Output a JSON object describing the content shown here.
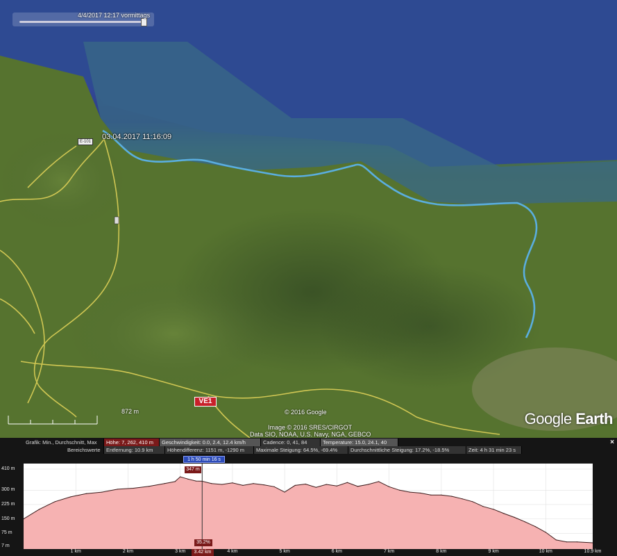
{
  "map": {
    "time_slider_label": "4/4/2017 12:17 vormittags",
    "track_timestamp": "03.04.2017 11:16:09",
    "road_badge": "VE1",
    "small_badge": "E-101",
    "scale_label": "872 m",
    "credit_copyright": "© 2016 Google",
    "credit_image": "Image © 2016 SRES/CIRGOT",
    "credit_data": "Data SIO, NOAA, U.S. Navy, NGA, GEBCO",
    "logo_google": "Google",
    "logo_earth": "Earth",
    "track_color": "#5aaee0",
    "road_color": "#e6d65a"
  },
  "profile": {
    "row1_header": "Grafik: Min., Durchschnitt, Max",
    "row1_hoehe": "Höhe: 7, 262, 410 m",
    "row1_speed": "Geschwindigkeit: 0.0, 2.4, 12.4 km/h",
    "row1_cadence": "Cadence: 0, 41, 84",
    "row1_temp": "Temperature: 15.0, 24.1, 40",
    "row2_header": "Bereichswerte",
    "row2_distance": "Entfernung: 10.9 km",
    "row2_hdiff": "Höhendifferenz: 1151 m, -1290 m",
    "row2_maxslope": "Maximale Steigung: 64.5%, -69.4%",
    "row2_avgslope": "Durchschnittliche Steigung: 17.2%, -18.5%",
    "row2_time": "Zeit: 4 h 31 min 23 s",
    "close": "×",
    "cursor_time": "1 h 50 min 16 s",
    "cursor_alt": "347 m",
    "cursor_grade": "35.2%",
    "cursor_dist": "3.42 km",
    "fill_color": "#f6b2b2",
    "line_color": "#3b1a1a"
  },
  "chart_data": {
    "type": "area",
    "title": "",
    "xlabel": "",
    "ylabel": "",
    "x_unit": "km",
    "y_unit": "m",
    "xlim": [
      0,
      10.9
    ],
    "ylim": [
      7,
      410
    ],
    "y_ticks": [
      "410 m",
      "300 m",
      "225 m",
      "150 m",
      "75 m",
      "7 m"
    ],
    "y_tick_values": [
      410,
      300,
      225,
      150,
      75,
      7
    ],
    "x_ticks": [
      "1 km",
      "2 km",
      "3 km",
      "4 km",
      "5 km",
      "6 km",
      "7 km",
      "8 km",
      "9 km",
      "10 km",
      "10.9 km"
    ],
    "x_tick_values": [
      1,
      2,
      3,
      4,
      5,
      6,
      7,
      8,
      9,
      10,
      10.9
    ],
    "series": [
      {
        "x": [
          0,
          0.3,
          0.6,
          0.9,
          1.2,
          1.5,
          1.8,
          2.1,
          2.4,
          2.7,
          2.9,
          3.0,
          3.15,
          3.3,
          3.42,
          3.6,
          3.8,
          4.0,
          4.2,
          4.4,
          4.6,
          4.8,
          5.0,
          5.2,
          5.4,
          5.6,
          5.8,
          6.0,
          6.2,
          6.4,
          6.6,
          6.8,
          7.0,
          7.2,
          7.4,
          7.6,
          7.8,
          8.0,
          8.2,
          8.4,
          8.6,
          8.8,
          9.0,
          9.2,
          9.4,
          9.6,
          9.8,
          10.0,
          10.2,
          10.4,
          10.6,
          10.9
        ],
        "y": [
          150,
          200,
          240,
          265,
          282,
          290,
          305,
          310,
          320,
          335,
          345,
          370,
          358,
          348,
          347,
          335,
          330,
          338,
          325,
          335,
          328,
          318,
          290,
          325,
          332,
          315,
          330,
          322,
          340,
          320,
          330,
          345,
          318,
          300,
          290,
          285,
          275,
          275,
          268,
          255,
          240,
          215,
          200,
          178,
          158,
          135,
          110,
          80,
          40,
          30,
          30,
          25
        ]
      }
    ]
  }
}
